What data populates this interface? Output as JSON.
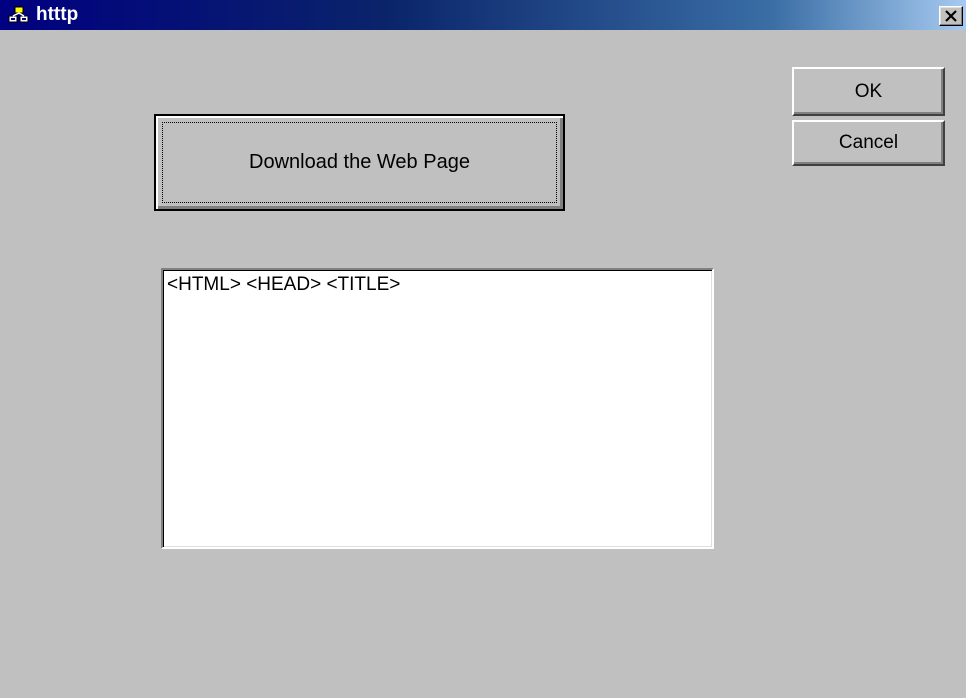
{
  "window": {
    "title": "htttp",
    "close_label": "✕"
  },
  "buttons": {
    "ok_label": "OK",
    "cancel_label": "Cancel",
    "download_label": "Download the Web Page"
  },
  "output": {
    "text": "<HTML> <HEAD> <TITLE>"
  },
  "colors": {
    "titlebar_start": "#000080",
    "titlebar_end": "#a6caf0",
    "face": "#c0c0c0"
  }
}
